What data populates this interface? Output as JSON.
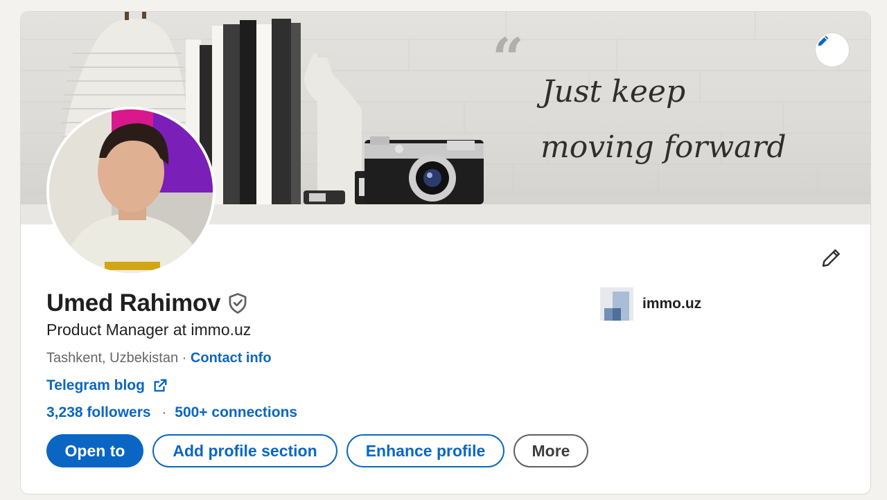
{
  "profile": {
    "name": "Umed Rahimov",
    "headline": "Product Manager at immo.uz",
    "location": "Tashkent, Uzbekistan",
    "separator": "·",
    "contact_info": "Contact info",
    "website_label": "Telegram blog",
    "followers": "3,238 followers",
    "connections": "500+ connections"
  },
  "cover": {
    "quote_line1": "Just keep",
    "quote_line2": "moving forward"
  },
  "company": {
    "name": "immo.uz"
  },
  "actions": {
    "open_to": "Open to",
    "add_section": "Add profile section",
    "enhance": "Enhance profile",
    "more": "More"
  },
  "colors": {
    "accent": "#0a66c2",
    "text": "#1f1f1f",
    "muted": "#666666",
    "background": "#f4f2ee"
  },
  "icons": {
    "cover_edit": "pencil-icon",
    "intro_edit": "pencil-icon",
    "verified": "verified-shield-icon",
    "external_link": "external-link-icon"
  }
}
